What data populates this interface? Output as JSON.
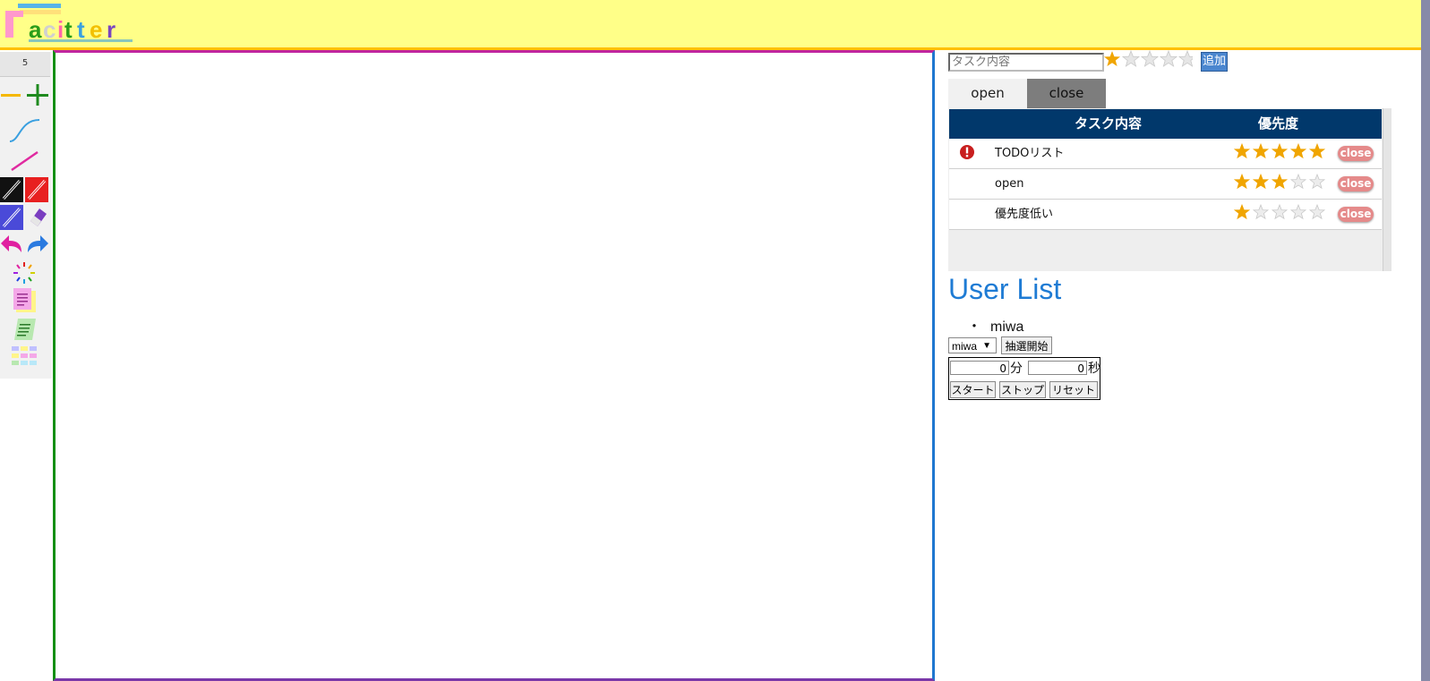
{
  "header": {
    "logo_text": "acitter",
    "logo_initial": "F"
  },
  "toolbar": {
    "line_width_value": "5",
    "tools": [
      {
        "name": "minus-icon"
      },
      {
        "name": "plus-icon"
      },
      {
        "name": "curve-pen-icon"
      },
      {
        "name": "line-pen-icon"
      },
      {
        "name": "black-pencil-icon"
      },
      {
        "name": "red-pencil-icon"
      },
      {
        "name": "blue-pencil-icon"
      },
      {
        "name": "eraser-icon"
      },
      {
        "name": "undo-icon"
      },
      {
        "name": "redo-icon"
      },
      {
        "name": "color-wheel-icon"
      },
      {
        "name": "sticky-note-icon"
      },
      {
        "name": "scroll-note-icon"
      },
      {
        "name": "grid-notes-icon"
      }
    ]
  },
  "task_form": {
    "placeholder": "タスク内容",
    "selected_stars": 1,
    "add_label": "追加"
  },
  "tabs": {
    "open_label": "open",
    "close_label": "close"
  },
  "task_table": {
    "headers": {
      "task": "タスク内容",
      "priority": "優先度"
    },
    "rows": [
      {
        "text": "TODOリスト",
        "stars": 5,
        "alert": true,
        "close_label": "close"
      },
      {
        "text": "open",
        "stars": 3,
        "alert": false,
        "close_label": "close"
      },
      {
        "text": "優先度低い",
        "stars": 1,
        "alert": false,
        "close_label": "close"
      }
    ]
  },
  "user_list": {
    "title": "User List",
    "bullet": "・",
    "users": [
      "miwa"
    ],
    "selected_user": "miwa",
    "lottery_label": "抽選開始"
  },
  "timer": {
    "minutes": "0",
    "minutes_unit": "分",
    "seconds": "0",
    "seconds_unit": "秒",
    "start_label": "スタート",
    "stop_label": "ストップ",
    "reset_label": "リセット"
  },
  "colors": {
    "header_bg": "#ffff88",
    "header_border": "#ffc000",
    "table_header": "#01386b",
    "star": "#f0a500",
    "star_off": "#dcdcdc",
    "close_btn": "#e58a8a",
    "title_blue": "#1e7bd4"
  }
}
